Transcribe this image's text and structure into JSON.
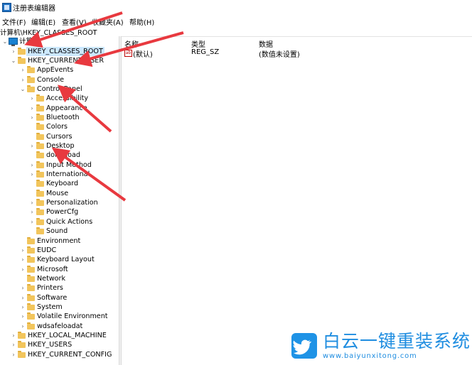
{
  "window": {
    "title": "注册表编辑器"
  },
  "menu": [
    "文件(F)",
    "编辑(E)",
    "查看(V)",
    "收藏夹(A)",
    "帮助(H)"
  ],
  "address": "计算机\\HKEY_CLASSES_ROOT",
  "tree": {
    "root": "计算机",
    "nodes": [
      {
        "label": "HKEY_CLASSES_ROOT",
        "level": 1,
        "expander": "collapsed",
        "selected": true
      },
      {
        "label": "HKEY_CURRENT_USER",
        "level": 1,
        "expander": "expanded"
      },
      {
        "label": "AppEvents",
        "level": 2,
        "expander": "collapsed"
      },
      {
        "label": "Console",
        "level": 2,
        "expander": "collapsed"
      },
      {
        "label": "Control Panel",
        "level": 2,
        "expander": "expanded"
      },
      {
        "label": "Accessibility",
        "level": 3,
        "expander": "collapsed"
      },
      {
        "label": "Appearance",
        "level": 3,
        "expander": "collapsed"
      },
      {
        "label": "Bluetooth",
        "level": 3,
        "expander": "collapsed"
      },
      {
        "label": "Colors",
        "level": 3,
        "expander": "none"
      },
      {
        "label": "Cursors",
        "level": 3,
        "expander": "none"
      },
      {
        "label": "Desktop",
        "level": 3,
        "expander": "collapsed"
      },
      {
        "label": "don't load",
        "level": 3,
        "expander": "none"
      },
      {
        "label": "Input Method",
        "level": 3,
        "expander": "collapsed"
      },
      {
        "label": "International",
        "level": 3,
        "expander": "collapsed"
      },
      {
        "label": "Keyboard",
        "level": 3,
        "expander": "none"
      },
      {
        "label": "Mouse",
        "level": 3,
        "expander": "none"
      },
      {
        "label": "Personalization",
        "level": 3,
        "expander": "collapsed"
      },
      {
        "label": "PowerCfg",
        "level": 3,
        "expander": "collapsed"
      },
      {
        "label": "Quick Actions",
        "level": 3,
        "expander": "collapsed"
      },
      {
        "label": "Sound",
        "level": 3,
        "expander": "none"
      },
      {
        "label": "Environment",
        "level": 2,
        "expander": "none"
      },
      {
        "label": "EUDC",
        "level": 2,
        "expander": "collapsed"
      },
      {
        "label": "Keyboard Layout",
        "level": 2,
        "expander": "collapsed"
      },
      {
        "label": "Microsoft",
        "level": 2,
        "expander": "collapsed"
      },
      {
        "label": "Network",
        "level": 2,
        "expander": "none"
      },
      {
        "label": "Printers",
        "level": 2,
        "expander": "collapsed"
      },
      {
        "label": "Software",
        "level": 2,
        "expander": "collapsed"
      },
      {
        "label": "System",
        "level": 2,
        "expander": "collapsed"
      },
      {
        "label": "Volatile Environment",
        "level": 2,
        "expander": "collapsed"
      },
      {
        "label": "wdsafeloadat",
        "level": 2,
        "expander": "collapsed"
      },
      {
        "label": "HKEY_LOCAL_MACHINE",
        "level": 1,
        "expander": "collapsed"
      },
      {
        "label": "HKEY_USERS",
        "level": 1,
        "expander": "collapsed"
      },
      {
        "label": "HKEY_CURRENT_CONFIG",
        "level": 1,
        "expander": "collapsed"
      }
    ]
  },
  "list": {
    "headers": [
      "名称",
      "类型",
      "数据"
    ],
    "rows": [
      {
        "icon": "ab",
        "name": "(默认)",
        "type": "REG_SZ",
        "data": "(数值未设置)"
      }
    ]
  },
  "watermark": {
    "title": "白云一键重装系统",
    "url": "www.baiyunxitong.com"
  },
  "colors": {
    "selection": "#cce8ff",
    "folder": "#f2c55c",
    "arrow": "#e8393f",
    "watermark": "#1f8de0"
  }
}
